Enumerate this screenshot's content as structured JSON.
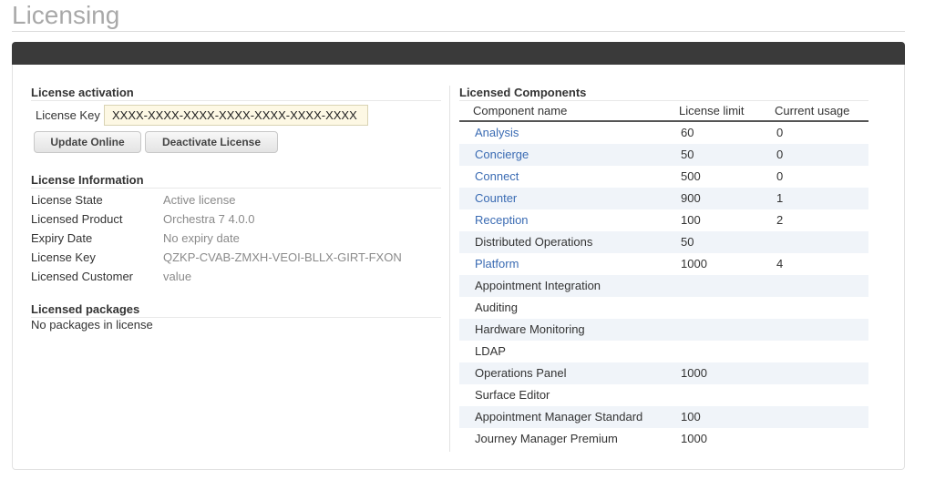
{
  "page": {
    "title": "Licensing"
  },
  "activation": {
    "title": "License activation",
    "key_label": "License Key",
    "key_value": "XXXX-XXXX-XXXX-XXXX-XXXX-XXXX-XXXX",
    "update_button": "Update Online",
    "deactivate_button": "Deactivate License"
  },
  "info": {
    "title": "License Information",
    "rows": [
      {
        "label": "License State",
        "value": "Active license"
      },
      {
        "label": "Licensed Product",
        "value": "Orchestra 7 4.0.0"
      },
      {
        "label": "Expiry Date",
        "value": "No expiry date"
      },
      {
        "label": "License Key",
        "value": "QZKP-CVAB-ZMXH-VEOI-BLLX-GIRT-FXON"
      },
      {
        "label": "Licensed Customer",
        "value": "value"
      }
    ]
  },
  "packages": {
    "title": "Licensed packages",
    "empty_text": "No packages in license"
  },
  "components": {
    "title": "Licensed Components",
    "headers": [
      "Component name",
      "License limit",
      "Current usage"
    ],
    "link_color": "#3a6bb3",
    "rows": [
      {
        "name": "Analysis",
        "limit": "60",
        "usage": "0",
        "link": true
      },
      {
        "name": "Concierge",
        "limit": "50",
        "usage": "0",
        "link": true
      },
      {
        "name": "Connect",
        "limit": "500",
        "usage": "0",
        "link": true
      },
      {
        "name": "Counter",
        "limit": "900",
        "usage": "1",
        "link": true
      },
      {
        "name": "Reception",
        "limit": "100",
        "usage": "2",
        "link": true
      },
      {
        "name": "Distributed Operations",
        "limit": "50",
        "usage": "",
        "link": false
      },
      {
        "name": "Platform",
        "limit": "1000",
        "usage": "4",
        "link": true
      },
      {
        "name": "Appointment Integration",
        "limit": "",
        "usage": "",
        "link": false
      },
      {
        "name": "Auditing",
        "limit": "",
        "usage": "",
        "link": false
      },
      {
        "name": "Hardware Monitoring",
        "limit": "",
        "usage": "",
        "link": false
      },
      {
        "name": "LDAP",
        "limit": "",
        "usage": "",
        "link": false
      },
      {
        "name": "Operations Panel",
        "limit": "1000",
        "usage": "",
        "link": false
      },
      {
        "name": "Surface Editor",
        "limit": "",
        "usage": "",
        "link": false
      },
      {
        "name": "Appointment Manager Standard",
        "limit": "100",
        "usage": "",
        "link": false
      },
      {
        "name": "Journey Manager Premium",
        "limit": "1000",
        "usage": "",
        "link": false
      }
    ]
  }
}
